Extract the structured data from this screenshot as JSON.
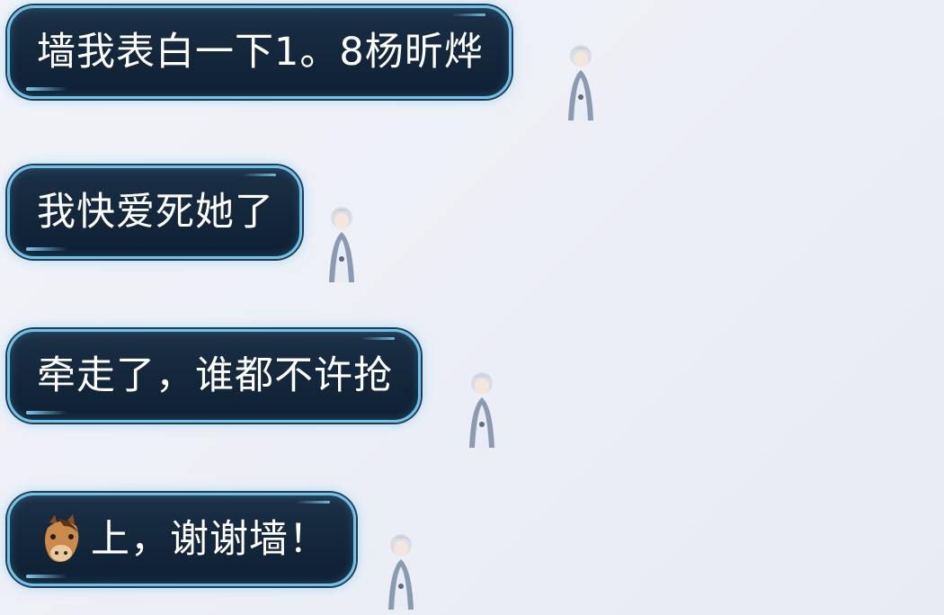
{
  "messages": [
    {
      "text": "墙我表白一下1。8杨昕烨"
    },
    {
      "text": "我快爱死她了"
    },
    {
      "text": "牵走了，谁都不许抢"
    },
    {
      "emoji": "horse-face",
      "text": "上，谢谢墙！"
    }
  ],
  "colors": {
    "bubble_fill": "#13263a",
    "bubble_border": "#6fc3e8",
    "bubble_text": "#ffffff",
    "background": "#eceef6"
  },
  "icons": [
    "figure-decoration",
    "horse-face-emoji"
  ]
}
